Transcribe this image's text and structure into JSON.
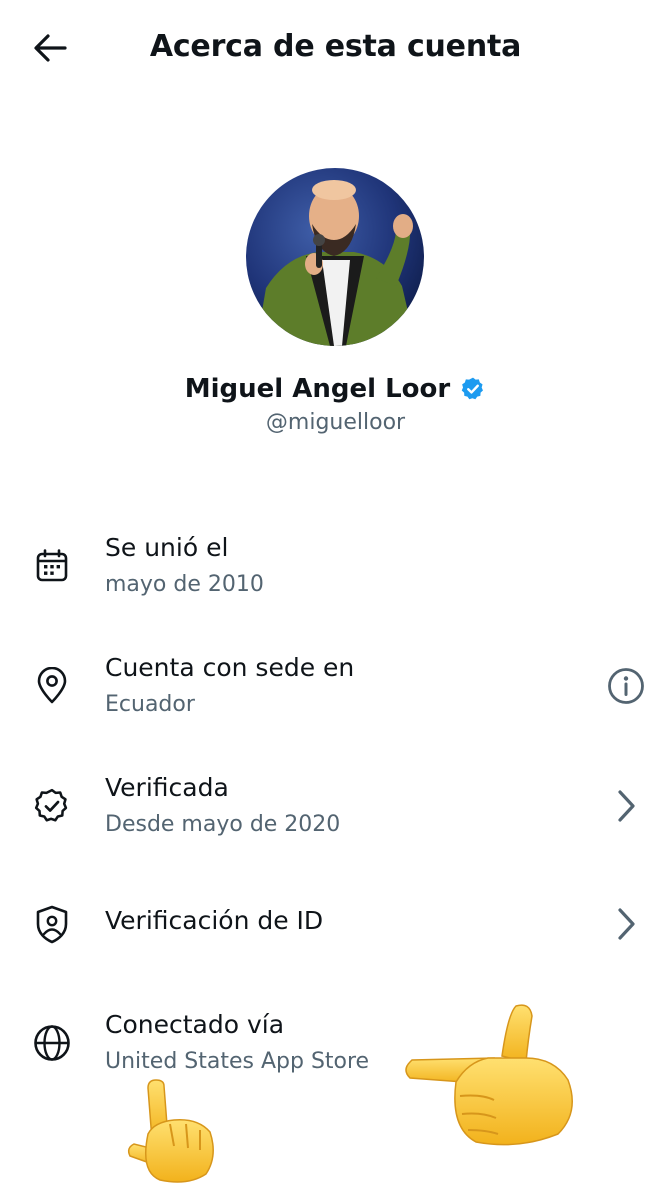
{
  "header": {
    "title": "Acerca de esta cuenta"
  },
  "profile": {
    "name": "Miguel Angel Loor",
    "handle": "@miguelloor",
    "verified": true,
    "badge_color": "#1d9bf0"
  },
  "rows": [
    {
      "label": "Se unió el",
      "sub": "mayo de 2010",
      "icon": "calendar-icon"
    },
    {
      "label": "Cuenta con sede en",
      "sub": "Ecuador",
      "icon": "location-pin-icon",
      "right_icon": "info-icon"
    },
    {
      "label": "Verificada",
      "sub": "Desde mayo de 2020",
      "icon": "verified-badge-icon",
      "right_icon": "chevron-right-icon"
    },
    {
      "label": "Verificación de ID",
      "icon": "id-shield-icon",
      "right_icon": "chevron-right-icon"
    },
    {
      "label": "Conectado vía",
      "sub": "United States App Store",
      "icon": "globe-icon"
    }
  ],
  "colors": {
    "text": "#0f1419",
    "secondary": "#536471",
    "accent": "#1d9bf0"
  },
  "emojis": [
    "pointing-left-hand-emoji",
    "pointing-up-hand-emoji"
  ]
}
